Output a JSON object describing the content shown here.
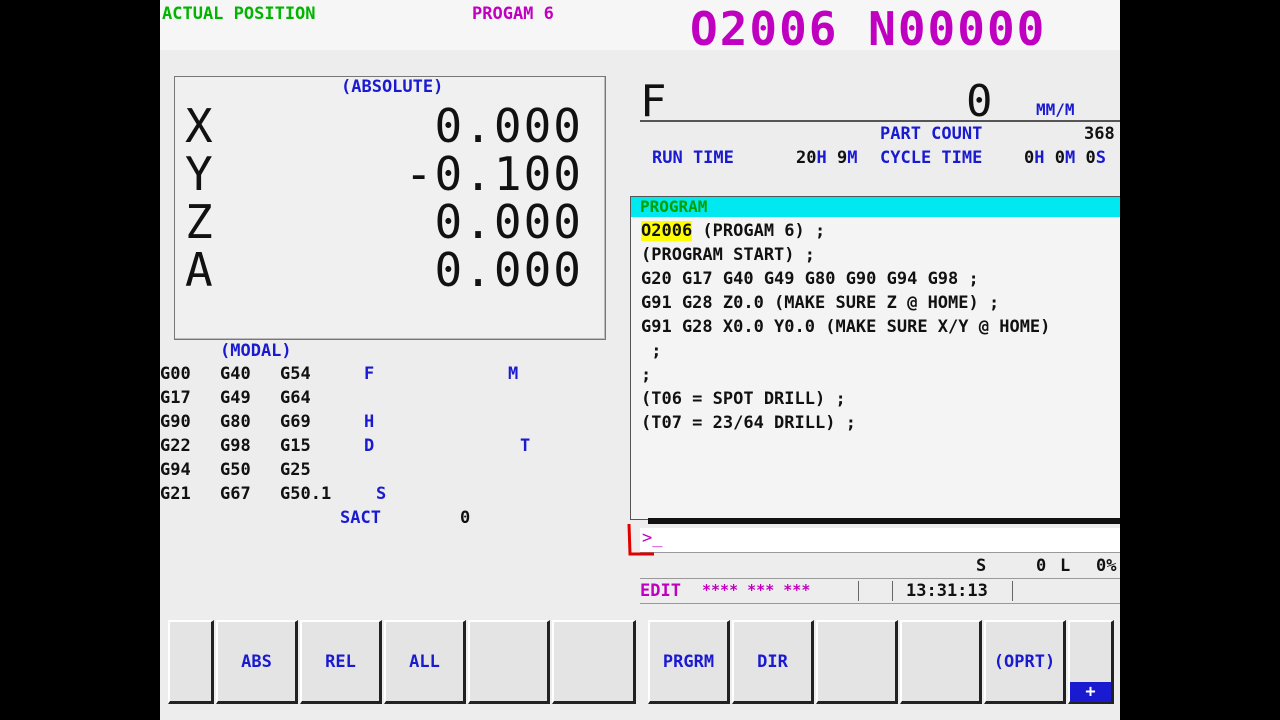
{
  "header": {
    "screen_name": "ACTUAL POSITION",
    "program_label": "PROGAM 6",
    "program_number": "O2006 N00000"
  },
  "position": {
    "mode_label": "(ABSOLUTE)",
    "axes": [
      {
        "axis": "X",
        "value": "0.000"
      },
      {
        "axis": "Y",
        "value": "-0.100"
      },
      {
        "axis": "Z",
        "value": "0.000"
      },
      {
        "axis": "A",
        "value": "0.000"
      }
    ]
  },
  "modal": {
    "title": "(MODAL)",
    "rows": [
      {
        "c1": "G00",
        "c2": "G40",
        "c3": "G54",
        "c4": "F",
        "c5": "",
        "c6": "M"
      },
      {
        "c1": "G17",
        "c2": "G49",
        "c3": "G64",
        "c4": "",
        "c5": "",
        "c6": ""
      },
      {
        "c1": "G90",
        "c2": "G80",
        "c3": "G69",
        "c4": "H",
        "c5": "",
        "c6": ""
      },
      {
        "c1": "G22",
        "c2": "G98",
        "c3": "G15",
        "c4": "D",
        "c5": "",
        "c6": "T"
      },
      {
        "c1": "G94",
        "c2": "G50",
        "c3": "G25",
        "c4": "",
        "c5": "",
        "c6": ""
      },
      {
        "c1": "G21",
        "c2": "G67",
        "c3": "G50.1",
        "c4": "S",
        "c5": "",
        "c6": ""
      }
    ],
    "sact_label": "SACT",
    "sact_value": "0"
  },
  "feed": {
    "label": "F",
    "value": "0",
    "unit": "MM/M"
  },
  "counters": {
    "part_count_label": "PART COUNT",
    "part_count_value": "368",
    "run_time_label": "RUN TIME",
    "run_time_h": "20",
    "run_time_h_unit": "H",
    "run_time_m": "9",
    "run_time_m_unit": "M",
    "cycle_time_label": "CYCLE TIME",
    "cycle_time_h": "0",
    "cycle_time_h_unit": "H",
    "cycle_time_m": "0",
    "cycle_time_m_unit": "M",
    "cycle_time_s": "0",
    "cycle_time_s_unit": "S"
  },
  "program": {
    "title": "PROGRAM",
    "first_number": "O2006",
    "first_rest": " (PROGAM 6) ;",
    "lines": [
      "(PROGRAM START) ;",
      "G20 G17 G40 G49 G80 G90 G94 G98 ;",
      "G91 G28 Z0.0 (MAKE SURE Z @ HOME) ;",
      "G91 G28 X0.0 Y0.0 (MAKE SURE X/Y @ HOME)",
      " ;",
      ";",
      "(T06 = SPOT DRILL) ;",
      "(T07 = 23/64 DRILL) ;"
    ]
  },
  "input": {
    "prompt": ">_"
  },
  "spindle_status": {
    "s_label": "S",
    "s_value": "0",
    "l_label": "L",
    "l_value": "0%"
  },
  "status": {
    "mode": "EDIT",
    "flags": "**** *** ***",
    "clock": "13:31:13"
  },
  "softkeys": [
    {
      "label": ""
    },
    {
      "label": "ABS"
    },
    {
      "label": "REL"
    },
    {
      "label": "ALL"
    },
    {
      "label": ""
    },
    {
      "label": ""
    },
    {
      "label": "PRGRM"
    },
    {
      "label": "DIR"
    },
    {
      "label": ""
    },
    {
      "label": ""
    },
    {
      "label": "(OPRT)"
    },
    {
      "label": "+"
    }
  ],
  "colors": {
    "screen_bg": "#ededed",
    "title_green": "#00b400",
    "program_magenta": "#c000c0",
    "label_blue": "#1a1ad0",
    "program_bar_cyan": "#00e8f0",
    "highlight_yellow": "#ffff00"
  }
}
